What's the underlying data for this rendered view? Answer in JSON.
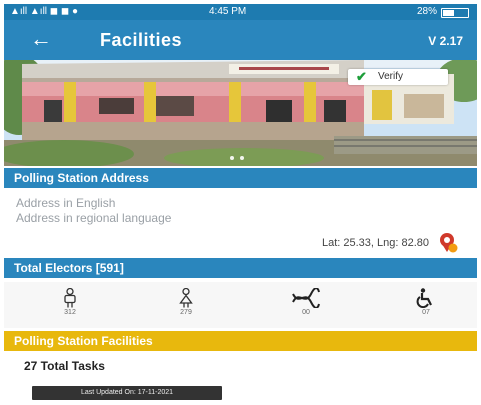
{
  "status_bar": {
    "left_icons": "▲ıll ▲ıll ◼ ◼ ●",
    "time": "4:45 PM",
    "right_text": "28%",
    "battery_percent": 44
  },
  "app_bar": {
    "back_icon": "arrow-left-icon",
    "title": "Facilities",
    "version": "V 2.17"
  },
  "photo": {
    "verify_label": "Verify"
  },
  "polling_station_address": {
    "header": "Polling Station Address",
    "address_english": "Address in English",
    "address_regional": "Address in regional language",
    "latlng": "Lat: 25.33, Lng: 82.80"
  },
  "electors": {
    "header": "Total Electors [591]",
    "items": [
      {
        "icon": "male-icon",
        "count": "312"
      },
      {
        "icon": "female-icon",
        "count": "279"
      },
      {
        "icon": "third-gender-icon",
        "count": "00"
      },
      {
        "icon": "wheelchair-icon",
        "count": "07"
      }
    ]
  },
  "facilities": {
    "header": "Polling Station Facilities",
    "total_tasks": "27 Total Tasks"
  },
  "toast": {
    "text": "Last Updated On: 17-11-2021"
  },
  "colors": {
    "primary": "#2a86bd",
    "status_bar": "#1e7bb0",
    "accent_yellow": "#e8b80d",
    "pin_red": "#d0392b"
  }
}
